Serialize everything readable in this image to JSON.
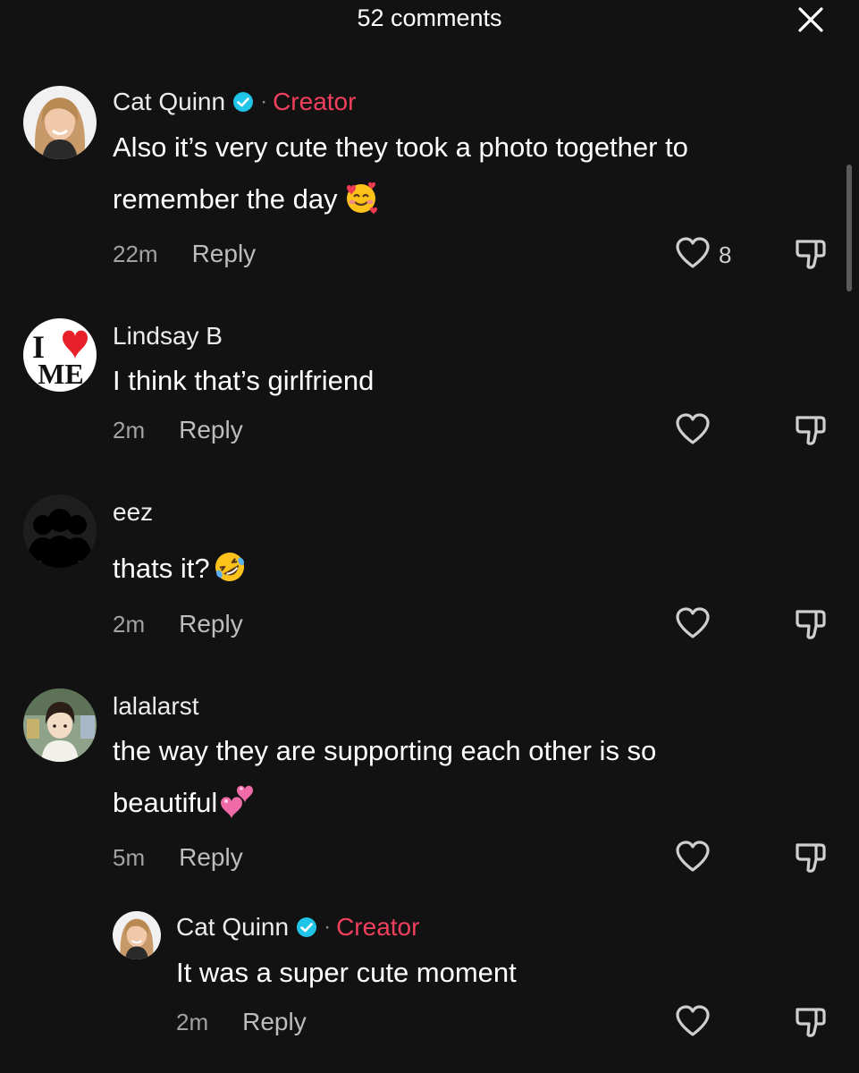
{
  "header": {
    "title": "52 comments",
    "close_icon": "close-icon"
  },
  "colors": {
    "background": "#121212",
    "creator": "#f0405e",
    "verified": "#20c4e6"
  },
  "comments": [
    {
      "username": "Cat Quinn",
      "verified": true,
      "separator": "·",
      "badge": "Creator",
      "text_lines": [
        "Also it’s very cute they took a photo together to",
        "remember the day"
      ],
      "emoji": "smiling-face-with-hearts-emoji",
      "time": "22m",
      "reply_label": "Reply",
      "likes": "8"
    },
    {
      "username": "Lindsay B",
      "avatar_text": [
        "I",
        "ME"
      ],
      "text_lines": [
        "I think that’s girlfriend"
      ],
      "time": "2m",
      "reply_label": "Reply"
    },
    {
      "username": "eez",
      "text_lines": [
        "thats it?"
      ],
      "emoji": "rolling-on-floor-laughing-emoji",
      "time": "2m",
      "reply_label": "Reply"
    },
    {
      "username": "lalalarst",
      "text_lines": [
        "the way they are supporting each other is so",
        "beautiful"
      ],
      "emoji": "two-hearts-emoji",
      "time": "5m",
      "reply_label": "Reply"
    },
    {
      "username": "Cat Quinn",
      "verified": true,
      "separator": "·",
      "badge": "Creator",
      "text_lines": [
        "It was a super cute moment"
      ],
      "time": "2m",
      "reply_label": "Reply"
    }
  ]
}
